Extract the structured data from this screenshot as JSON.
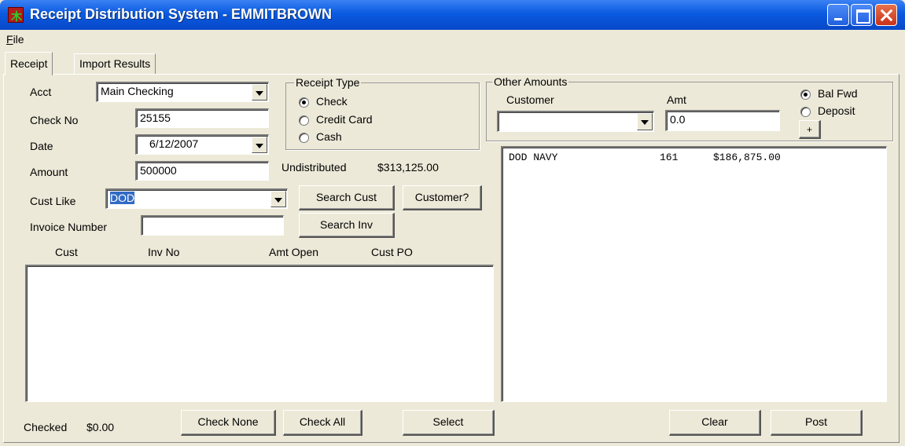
{
  "window": {
    "title": "Receipt Distribution System - EMMITBROWN",
    "icon_glyph": "木"
  },
  "menu": {
    "file": "File"
  },
  "tabs": [
    {
      "label": "Receipt"
    },
    {
      "label": "Import Results"
    }
  ],
  "form": {
    "acct_label": "Acct",
    "acct_value": "Main Checking",
    "check_no_label": "Check No",
    "check_no_value": "25155",
    "date_label": "Date",
    "date_value": "6/12/2007",
    "amount_label": "Amount",
    "amount_value": "500000",
    "cust_like_label": "Cust Like",
    "cust_like_value": "DOD",
    "invoice_label": "Invoice Number",
    "invoice_value": "",
    "undistributed_label": "Undistributed",
    "undistributed_value": "$313,125.00"
  },
  "receipt_type": {
    "legend": "Receipt Type",
    "options": [
      {
        "label": "Check",
        "checked": true
      },
      {
        "label": "Credit Card",
        "checked": false
      },
      {
        "label": "Cash",
        "checked": false
      }
    ]
  },
  "buttons": {
    "search_cust": "Search Cust",
    "customer_q": "Customer?",
    "search_inv": "Search Inv",
    "check_none": "Check None",
    "check_all": "Check All",
    "select": "Select",
    "clear": "Clear",
    "post": "Post",
    "plus": "+"
  },
  "invoice_list": {
    "columns": [
      "Cust",
      "Inv No",
      "Amt Open",
      "Cust PO"
    ],
    "rows": []
  },
  "other_amounts": {
    "legend": "Other Amounts",
    "customer_label": "Customer",
    "customer_value": "",
    "amt_label": "Amt",
    "amt_value": "0.0",
    "options": [
      {
        "label": "Bal Fwd",
        "checked": true
      },
      {
        "label": "Deposit",
        "checked": false
      }
    ]
  },
  "distribution_list": {
    "rows": [
      {
        "customer": "DOD NAVY",
        "inv": "161",
        "amount": "$186,875.00"
      }
    ]
  },
  "footer": {
    "checked_label": "Checked",
    "checked_value": "$0.00"
  }
}
